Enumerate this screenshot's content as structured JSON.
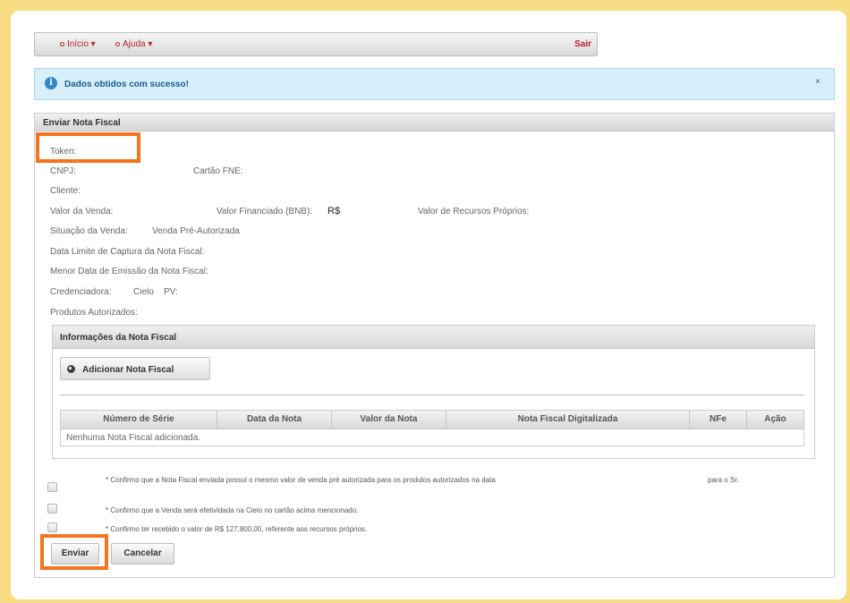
{
  "menu": {
    "inicio": "Início",
    "ajuda": "Ajuda",
    "sair": "Sair"
  },
  "alert": {
    "icon": "info-icon",
    "text": "Dados obtidos com sucesso!",
    "close": "×"
  },
  "panel": {
    "title": "Enviar Nota Fiscal",
    "fields": {
      "token": "Token:",
      "cnpj": "CNPJ:",
      "cartao_fne": "Cartão FNE:",
      "cliente": "Cliente:",
      "valor_venda": "Valor da Venda:",
      "valor_financiado": "Valor Financiado (BNB):",
      "valor_financiado_value": "R$",
      "valor_recursos": "Valor de Recursos Próprios:",
      "situacao": "Situação da Venda:",
      "situacao_value": "Venda Pré-Autorizada",
      "data_limite": "Data Limite de Captura da Nota Fiscal:",
      "menor_data": "Menor Data de Emissão da Nota Fiscal:",
      "credenciadora": "Credenciadora:",
      "credenciadora_value": "Cielo",
      "pv": "PV:",
      "produtos": "Produtos Autorizados:"
    }
  },
  "nota_fiscal": {
    "title": "Informações da Nota Fiscal",
    "add_button": "Adicionar Nota Fiscal",
    "columns": [
      "Número de Série",
      "Data da Nota",
      "Valor da Nota",
      "Nota Fiscal Digitalizada",
      "NFe",
      "Ação"
    ],
    "empty_text": "Nenhuma Nota Fiscal adicionada."
  },
  "confirmations": [
    {
      "text": "* Confirmo que a Nota Fiscal enviada possui o mesmo valor de venda pré autorizada para os produtos autorizados na data",
      "suffix": "para o Sr."
    },
    {
      "text": "* Confirmo que a Venda será efetividada na Cielo no cartão acima mencionado."
    },
    {
      "text": "* Confirmo ter recebido o valor de R$ 127.800,00, referente aos recursos próprios."
    }
  ],
  "buttons": {
    "enviar": "Enviar",
    "cancelar": "Cancelar"
  },
  "colors": {
    "background": "#f7dc84",
    "highlight": "#f47520",
    "menu_text": "#b2222d",
    "alert_bg": "#d7effb"
  }
}
